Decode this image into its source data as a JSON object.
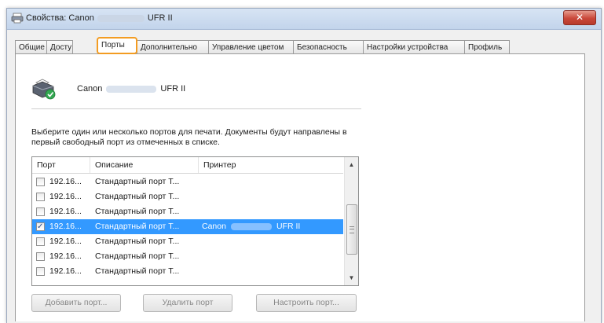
{
  "window": {
    "title_prefix": "Свойства: Canon",
    "title_suffix": "UFR II",
    "close_label": "✕"
  },
  "tabs": [
    {
      "label": "Общие"
    },
    {
      "label": "Досту"
    },
    {
      "label": "Порты"
    },
    {
      "label": "Дополнительно"
    },
    {
      "label": "Управление цветом"
    },
    {
      "label": "Безопасность"
    },
    {
      "label": "Настройки устройства"
    },
    {
      "label": "Профиль"
    }
  ],
  "printer": {
    "name_prefix": "Canon",
    "name_suffix": "UFR II"
  },
  "instructions": "Выберите один или несколько портов для печати. Документы будут направлены в первый свободный порт из отмеченных в списке.",
  "ports_table": {
    "columns": [
      "Порт",
      "Описание",
      "Принтер"
    ],
    "rows": [
      {
        "port": "192.16...",
        "description": "Стандартный порт Т...",
        "printer_prefix": "",
        "printer_suffix": "",
        "checked": false,
        "selected": false
      },
      {
        "port": "192.16...",
        "description": "Стандартный порт Т...",
        "printer_prefix": "",
        "printer_suffix": "",
        "checked": false,
        "selected": false
      },
      {
        "port": "192.16...",
        "description": "Стандартный порт Т...",
        "printer_prefix": "",
        "printer_suffix": "",
        "checked": false,
        "selected": false
      },
      {
        "port": "192.16...",
        "description": "Стандартный порт Т...",
        "printer_prefix": "Canon",
        "printer_suffix": "UFR II",
        "checked": true,
        "selected": true
      },
      {
        "port": "192.16...",
        "description": "Стандартный порт Т...",
        "printer_prefix": "",
        "printer_suffix": "",
        "checked": false,
        "selected": false
      },
      {
        "port": "192.16...",
        "description": "Стандартный порт Т...",
        "printer_prefix": "",
        "printer_suffix": "",
        "checked": false,
        "selected": false
      },
      {
        "port": "192.16...",
        "description": "Стандартный порт Т...",
        "printer_prefix": "",
        "printer_suffix": "",
        "checked": false,
        "selected": false
      }
    ]
  },
  "buttons": {
    "add_port": "Добавить порт...",
    "delete_port": "Удалить порт",
    "configure_port": "Настроить порт..."
  },
  "colors": {
    "active_tab_highlight": "#f39c22",
    "selection": "#3399ff"
  }
}
